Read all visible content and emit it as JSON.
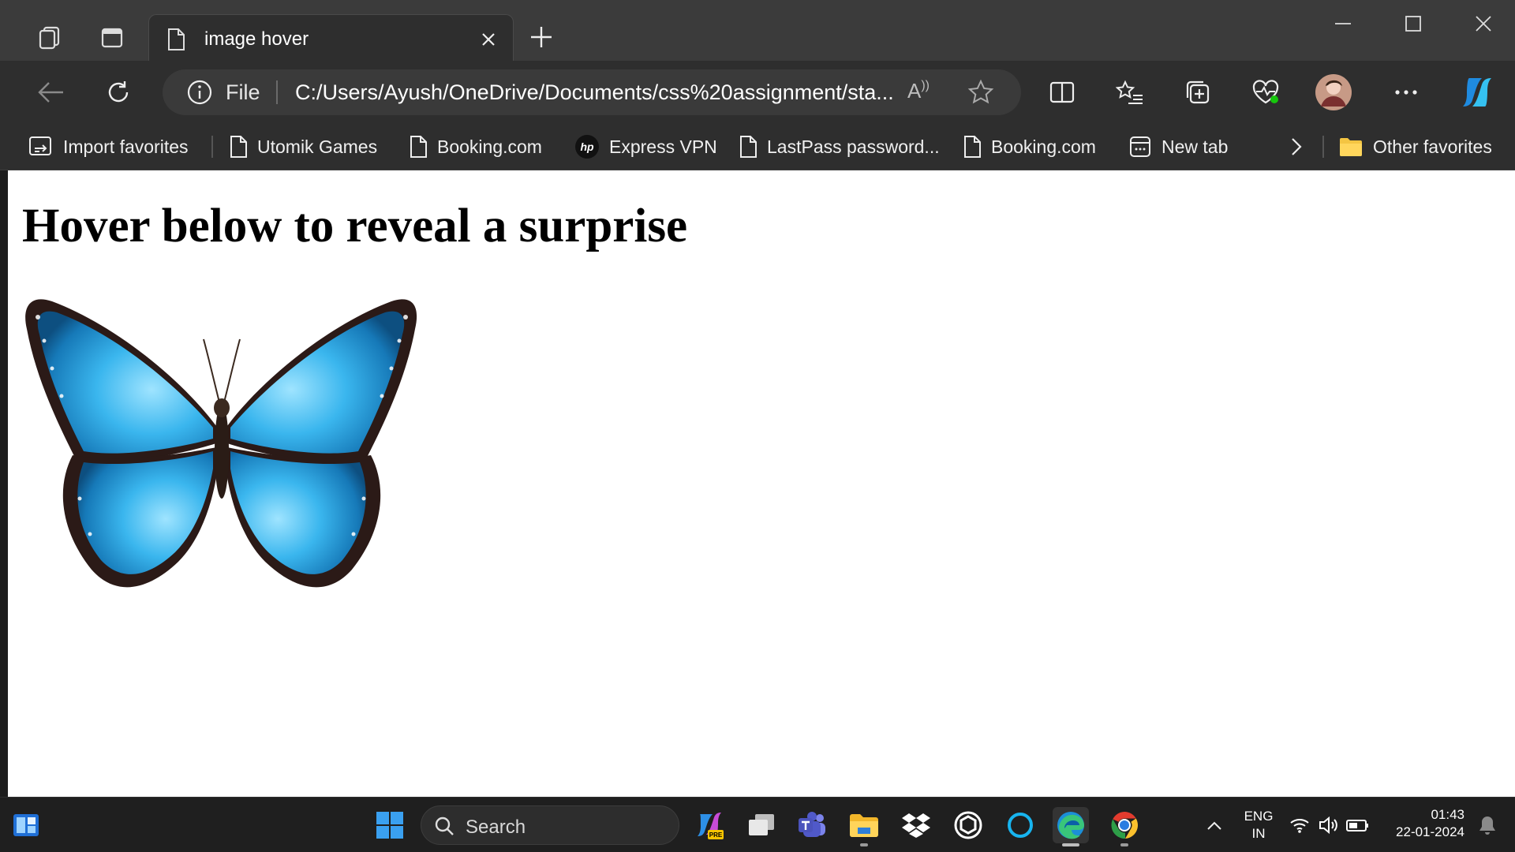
{
  "tab": {
    "title": "image hover"
  },
  "address_bar": {
    "protocol": "File",
    "url": "C:/Users/Ayush/OneDrive/Documents/css%20assignment/sta..."
  },
  "favorites": [
    {
      "label": "Import favorites",
      "icon": "import-icon"
    },
    {
      "label": "Utomik Games",
      "icon": "page-icon"
    },
    {
      "label": "Booking.com",
      "icon": "page-icon"
    },
    {
      "label": "Express VPN",
      "icon": "hp-logo-icon"
    },
    {
      "label": "LastPass password...",
      "icon": "page-icon"
    },
    {
      "label": "Booking.com",
      "icon": "page-icon"
    },
    {
      "label": "New tab",
      "icon": "new-tab-icon"
    }
  ],
  "other_favorites": "Other favorites",
  "page": {
    "heading": "Hover below to reveal a surprise"
  },
  "taskbar": {
    "search_placeholder": "Search",
    "language": "ENG",
    "region": "IN",
    "time": "01:43",
    "date": "22-01-2024"
  },
  "colors": {
    "browser_frame": "#3b3b3b",
    "toolbar": "#2e2e2e",
    "page_bg": "#ffffff",
    "taskbar": "#1f1f1f",
    "butterfly_blue": "#36b4ea"
  }
}
